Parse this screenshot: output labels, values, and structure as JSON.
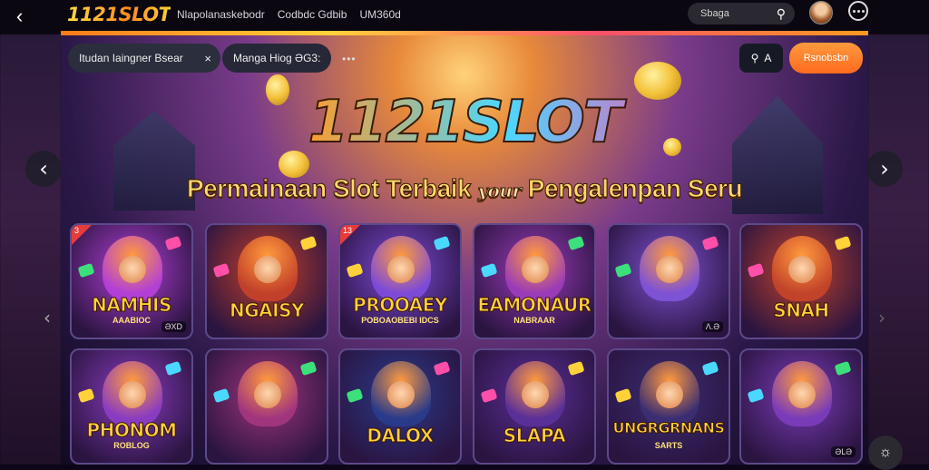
{
  "topbar": {
    "back_icon": "chevron-left-icon",
    "logo": "1121SLOT",
    "nav": [
      "Nlapolanaskebodr",
      "Codbdc Gdbib",
      "UM360d"
    ],
    "search_label": "Sbaga",
    "search_icon": "search-icon",
    "menu_icon": "more-dots-icon"
  },
  "hero": {
    "chip_1": "Itudan Iaingner Bsear",
    "chip_1_close": "×",
    "chip_2": "Manga Hiog ƏG3:",
    "chip_more": "•••",
    "action_button_text": "A",
    "cta_button": "Rsnobsbn",
    "title": "1121SLOT",
    "subtitle_1": "Permainaan Slot Terbaik",
    "subtitle_mid": "your",
    "subtitle_2": "Pengalenpan Seru"
  },
  "cards": [
    {
      "title": "NAMHIS",
      "sub": "AAABIOC",
      "badge": "ƏXD",
      "corner": "3",
      "color": "#b23fd6"
    },
    {
      "title": "NGAISY",
      "sub": "",
      "badge": "",
      "corner": "",
      "color": "#c2402a"
    },
    {
      "title": "PROOAEY",
      "sub": "POBOAOBEBI IDCS",
      "badge": "",
      "corner": "13",
      "color": "#7d4ad8"
    },
    {
      "title": "EAMONAUR",
      "sub": "NABRAAR",
      "badge": "",
      "corner": "",
      "color": "#9a3bb8"
    },
    {
      "title": "",
      "sub": "",
      "badge": "Λ.Ə",
      "corner": "",
      "color": "#7e52d4"
    },
    {
      "title": "SNAH",
      "sub": "",
      "badge": "",
      "corner": "",
      "color": "#c2432a"
    },
    {
      "title": "PHONOM",
      "sub": "ROBLOG",
      "badge": "",
      "corner": "",
      "color": "#8a3cc0"
    },
    {
      "title": "",
      "sub": "",
      "badge": "",
      "corner": "",
      "color": "#a0357e"
    },
    {
      "title": "DALOX",
      "sub": "",
      "badge": "",
      "corner": "",
      "color": "#2a3a8a"
    },
    {
      "title": "SLAPA",
      "sub": "",
      "badge": "",
      "corner": "",
      "color": "#5b2f98"
    },
    {
      "title": "UNGRGRNANS",
      "sub": "SARTS",
      "badge": "",
      "corner": "",
      "color": "#3a2d72"
    },
    {
      "title": "",
      "sub": "",
      "badge": "ƏLƏ",
      "corner": "",
      "color": "#7a3bb8"
    }
  ],
  "nav_arrows": {
    "left": "‹",
    "right": "›"
  }
}
